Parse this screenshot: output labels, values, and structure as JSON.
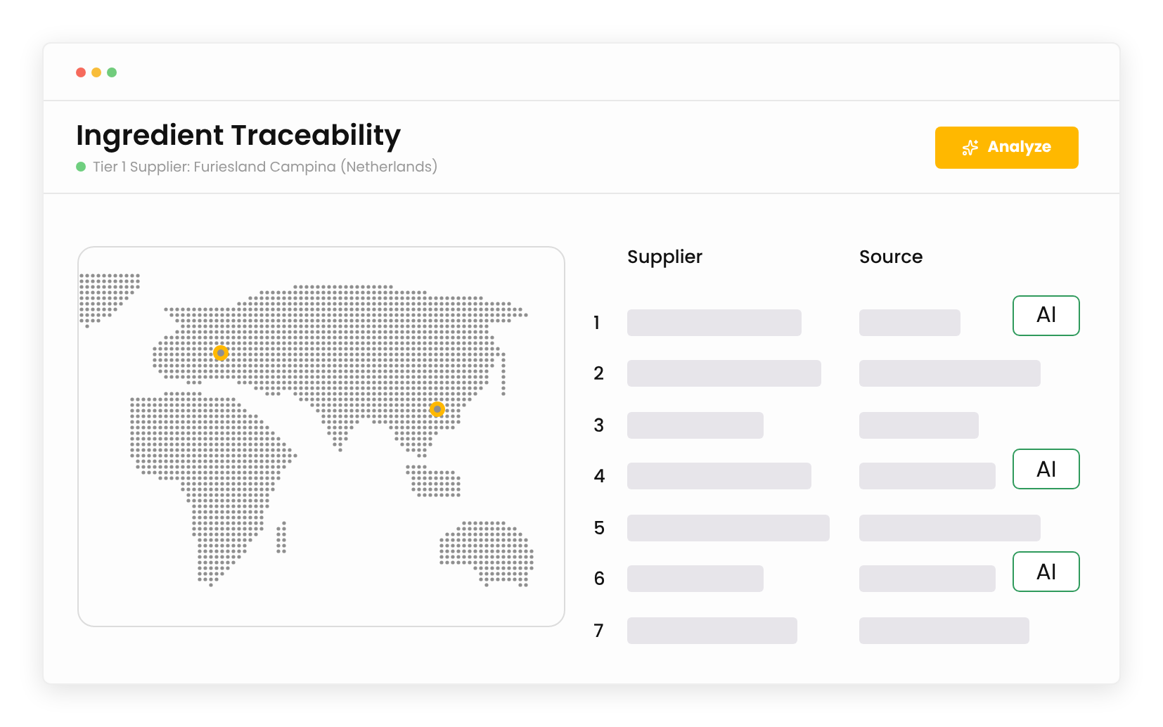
{
  "header": {
    "title": "Ingredient Traceability",
    "status": {
      "color": "#6fcf7f",
      "text": "Tier 1 Supplier: Furiesland Campina (Netherlands)"
    },
    "action": "Analyze"
  },
  "map": {
    "kind": "dot-map"
  },
  "table": {
    "columns": [
      "Supplier",
      "Source"
    ],
    "rows": [
      {
        "number": "1",
        "ai": true,
        "tag": "AI"
      },
      {
        "number": "2",
        "ai": false
      },
      {
        "number": "3",
        "ai": false
      },
      {
        "number": "4",
        "ai": true,
        "tag": "AI"
      },
      {
        "number": "5",
        "ai": false
      },
      {
        "number": "6",
        "ai": true,
        "tag": "AI"
      },
      {
        "number": "7",
        "ai": false
      }
    ]
  }
}
